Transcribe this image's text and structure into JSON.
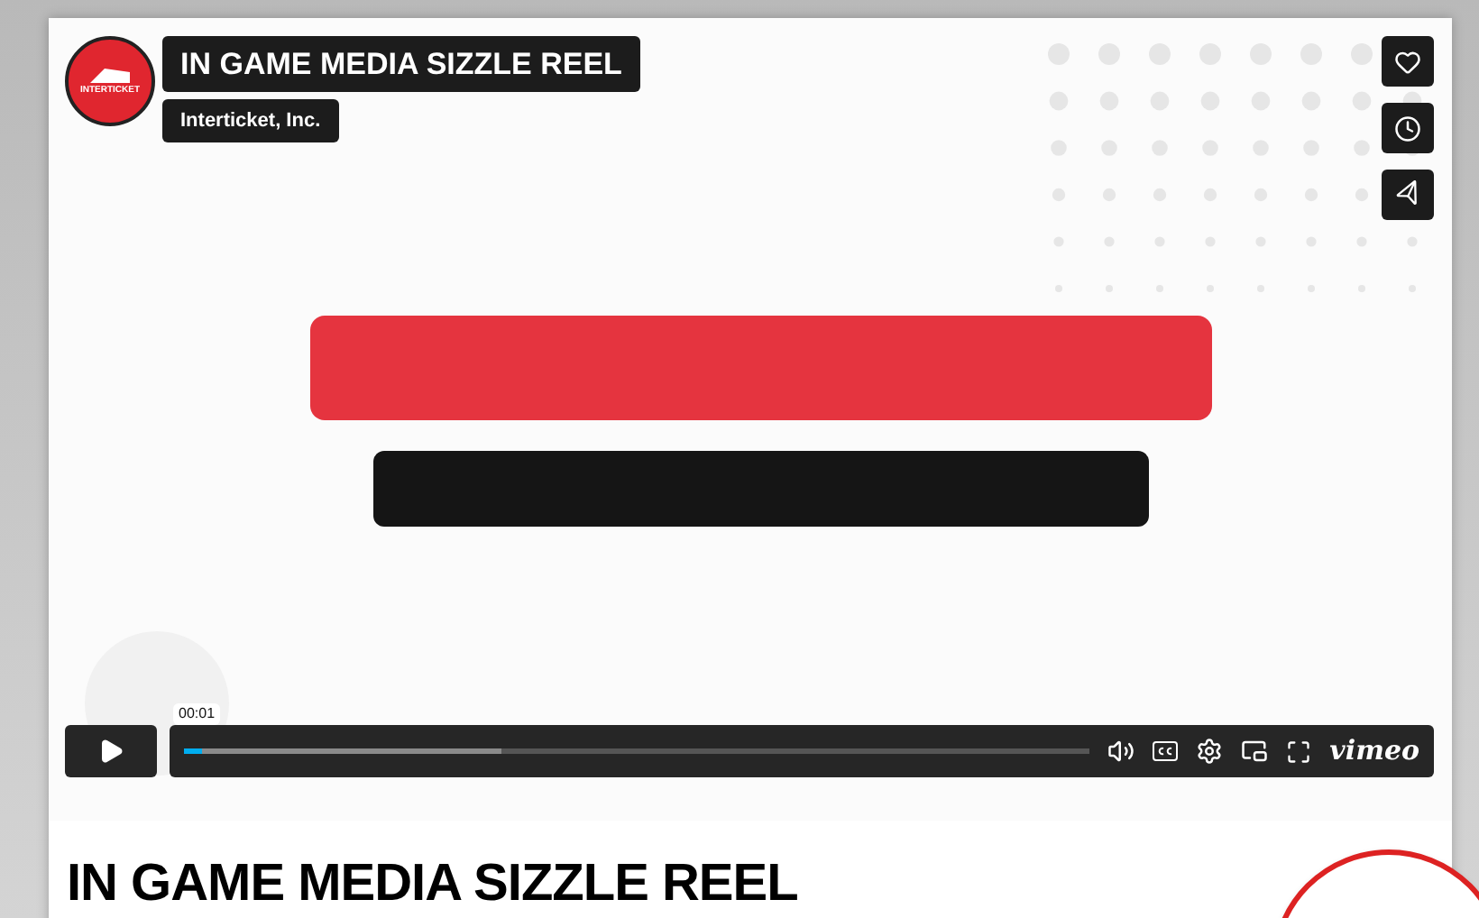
{
  "player": {
    "logo_text": "INTERTICKET",
    "title": "IN GAME MEDIA SIZZLE REEL",
    "byline": "Interticket, Inc.",
    "controls": {
      "playing": false,
      "time_tooltip": "00:01",
      "played": {
        "level": 0.02
      },
      "buffered": {
        "level": 0.35
      },
      "brand": "vimeo"
    }
  },
  "heading": "IN GAME MEDIA SIZZLE REEL"
}
